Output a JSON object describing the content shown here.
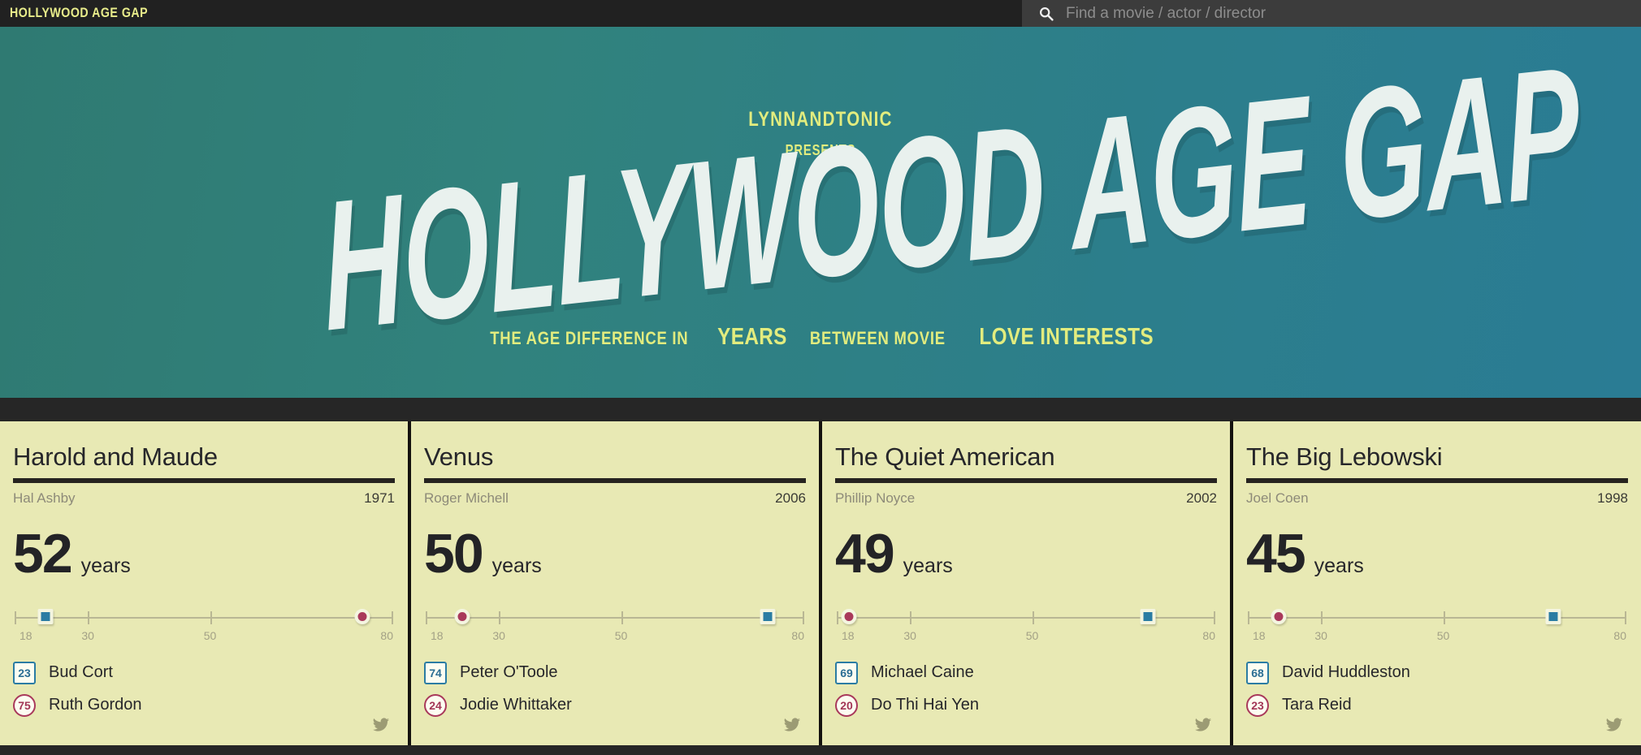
{
  "header": {
    "brand": "HOLLYWOOD AGE GAP",
    "search_placeholder": "Find a movie / actor / director",
    "search_value": "",
    "search_icon": "search-icon",
    "bar_color": "#212121",
    "search_bg": "#3c3c3c",
    "brand_color": "#e8ec8b"
  },
  "hero": {
    "presenter": "LYNNANDTONIC",
    "presents": "PRESENTS",
    "title": "HOLLYWOOD AGE GAP",
    "subtitle_parts": [
      {
        "text": "THE AGE DIFFERENCE IN",
        "size": "small"
      },
      {
        "text": "YEARS",
        "size": "large"
      },
      {
        "text": "BETWEEN MOVIE",
        "size": "small"
      },
      {
        "text": "LOVE INTERESTS",
        "size": "large"
      }
    ],
    "accent_color": "#e2ec7e",
    "title_color": "#e9f1ee",
    "bg_gradient_from": "#2f7a72",
    "bg_gradient_to": "#2a7c94"
  },
  "slider_axis": {
    "min": 18,
    "max": 80,
    "ticks": [
      18,
      30,
      50,
      80
    ],
    "tick_labels": [
      "18",
      "30",
      "50",
      "80"
    ]
  },
  "legend": {
    "male_color": "#2b7ca3",
    "female_color": "#a9395b",
    "card_bg": "#e8e9b4"
  },
  "unit_label": "years",
  "social_icon": "twitter-bird-icon",
  "cards": [
    {
      "title": "Harold and Maude",
      "director": "Hal Ashby",
      "year": "1971",
      "gap": "52",
      "unit": "years",
      "people": [
        {
          "age": "23",
          "age_num": 23,
          "name": "Bud Cort",
          "shape": "square",
          "gender": "male"
        },
        {
          "age": "75",
          "age_num": 75,
          "name": "Ruth Gordon",
          "shape": "circle",
          "gender": "female"
        }
      ]
    },
    {
      "title": "Venus",
      "director": "Roger Michell",
      "year": "2006",
      "gap": "50",
      "unit": "years",
      "people": [
        {
          "age": "74",
          "age_num": 74,
          "name": "Peter O'Toole",
          "shape": "square",
          "gender": "male"
        },
        {
          "age": "24",
          "age_num": 24,
          "name": "Jodie Whittaker",
          "shape": "circle",
          "gender": "female"
        }
      ]
    },
    {
      "title": "The Quiet American",
      "director": "Phillip Noyce",
      "year": "2002",
      "gap": "49",
      "unit": "years",
      "people": [
        {
          "age": "69",
          "age_num": 69,
          "name": "Michael Caine",
          "shape": "square",
          "gender": "male"
        },
        {
          "age": "20",
          "age_num": 20,
          "name": "Do Thi Hai Yen",
          "shape": "circle",
          "gender": "female"
        }
      ]
    },
    {
      "title": "The Big Lebowski",
      "director": "Joel Coen",
      "year": "1998",
      "gap": "45",
      "unit": "years",
      "people": [
        {
          "age": "68",
          "age_num": 68,
          "name": "David Huddleston",
          "shape": "square",
          "gender": "male"
        },
        {
          "age": "23",
          "age_num": 23,
          "name": "Tara Reid",
          "shape": "circle",
          "gender": "female"
        }
      ]
    }
  ]
}
